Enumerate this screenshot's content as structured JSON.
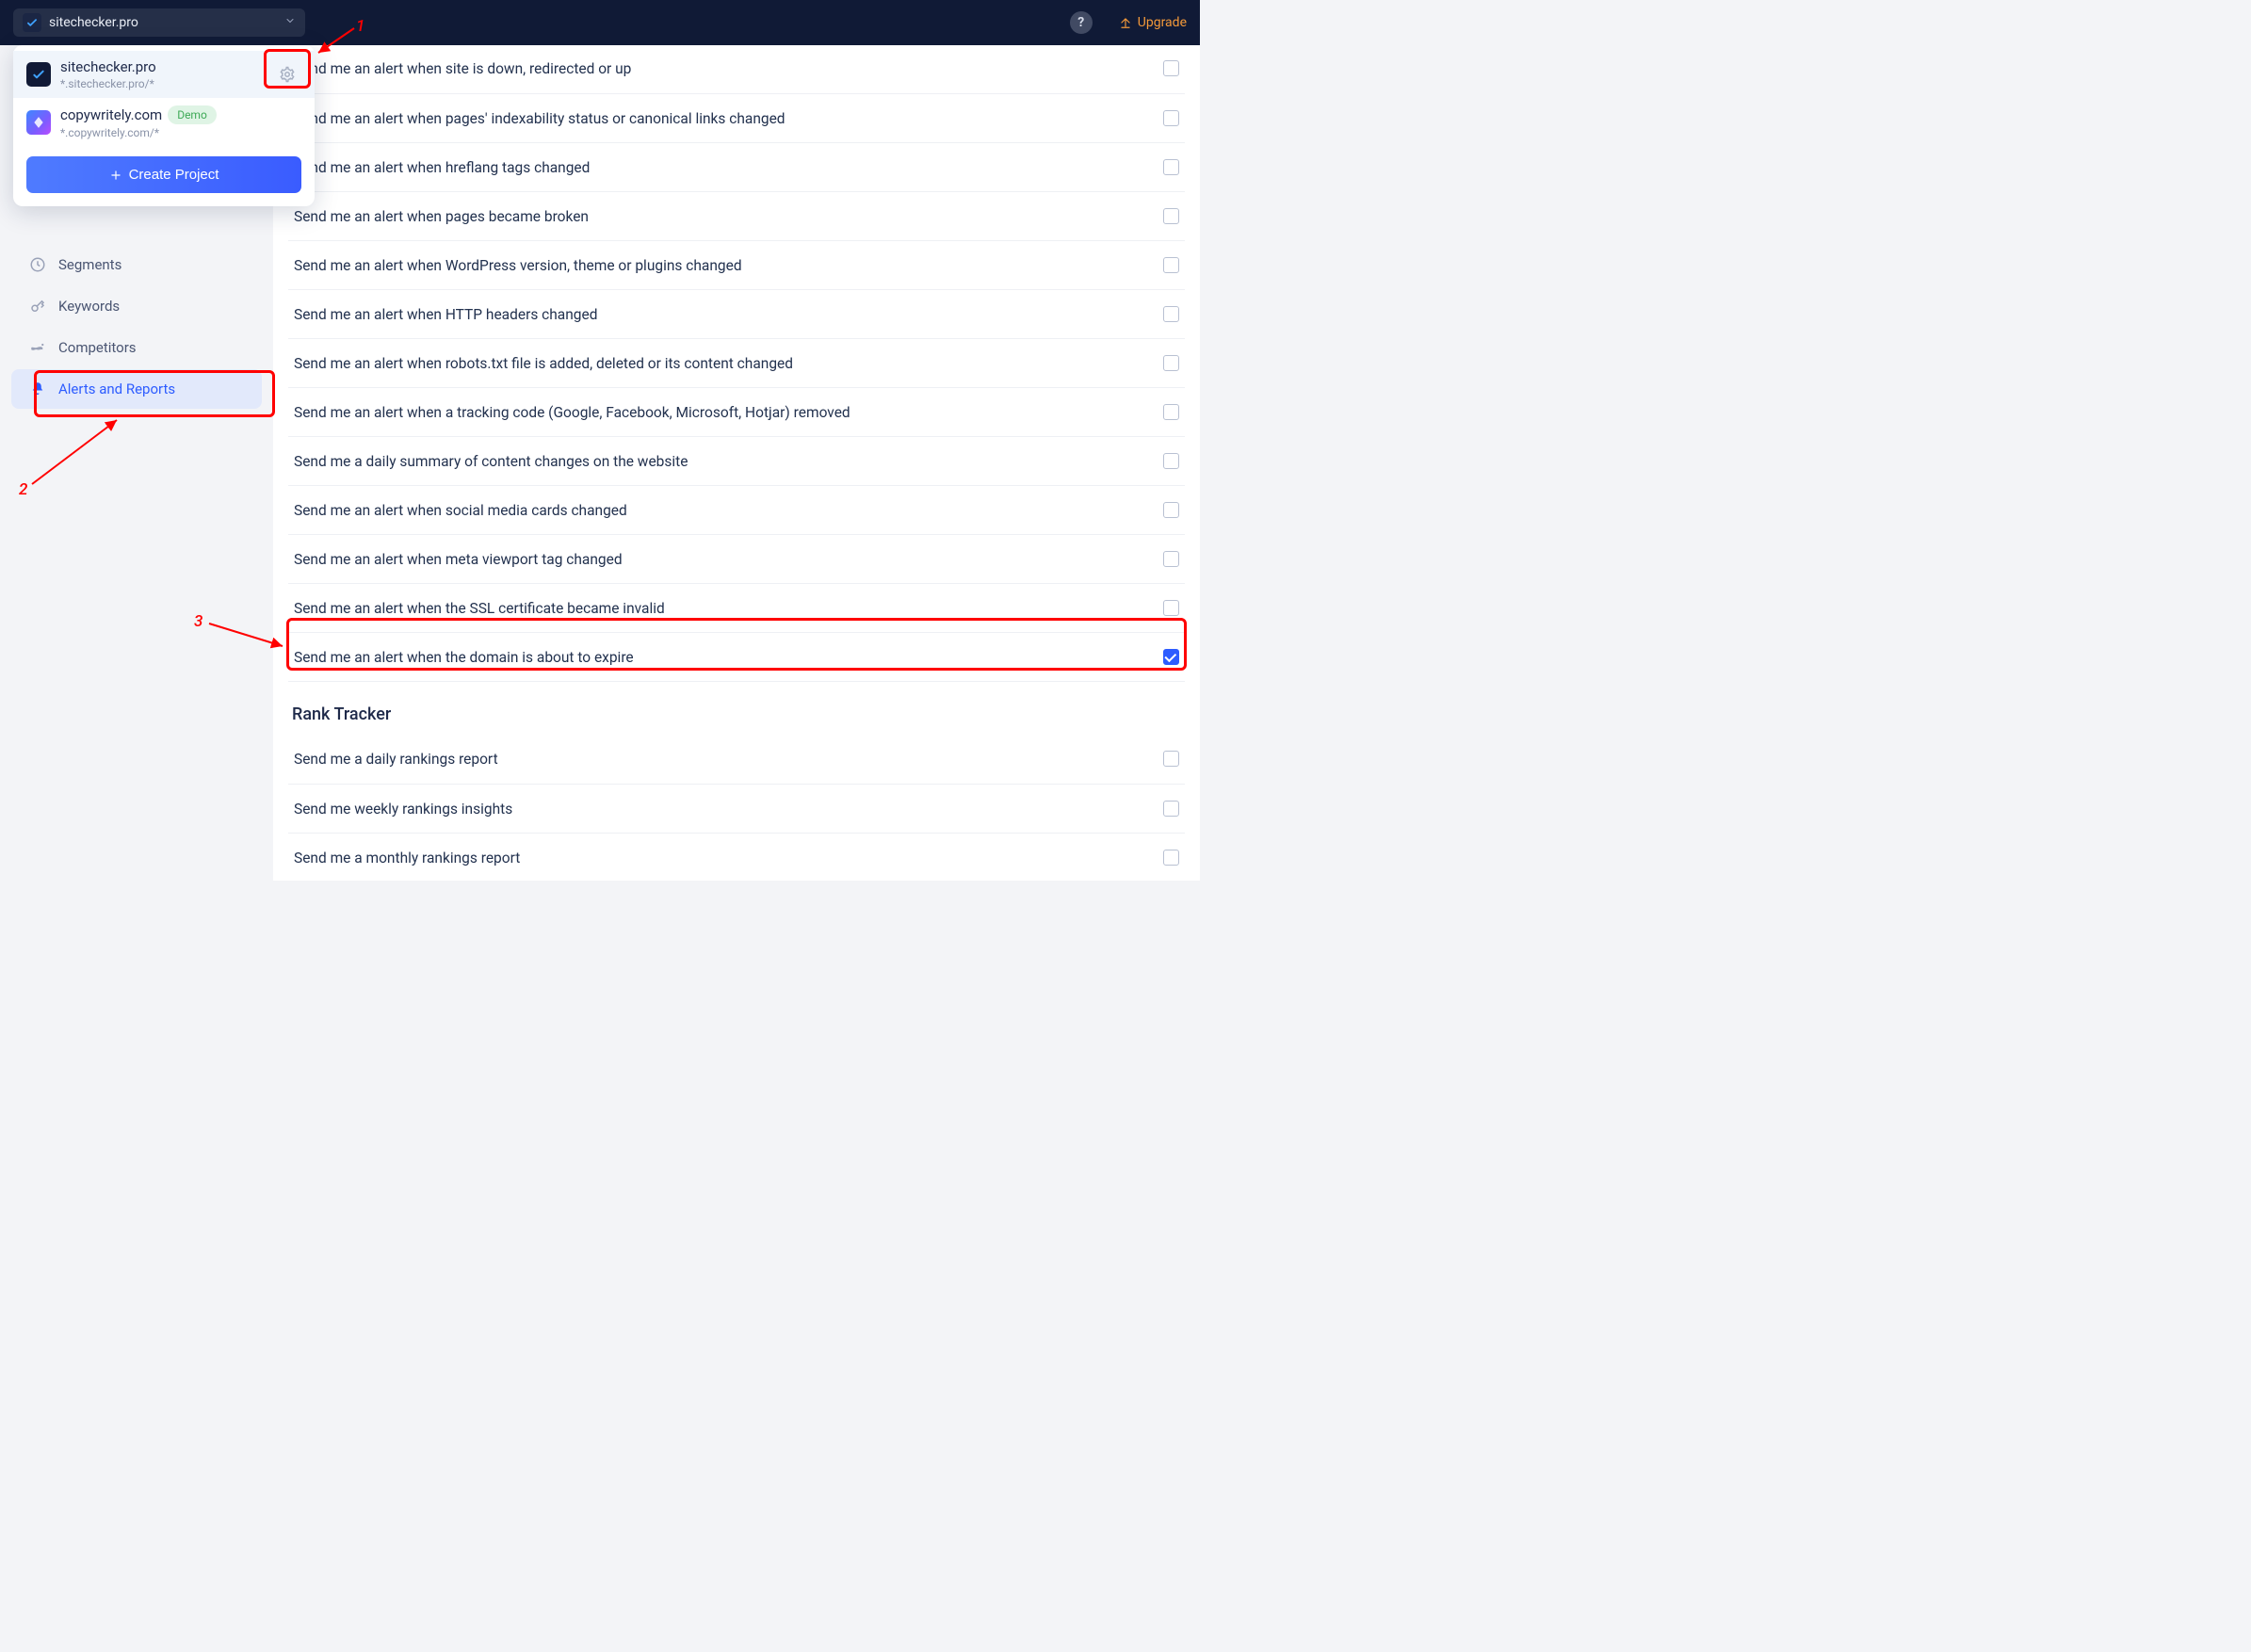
{
  "topbar": {
    "project_name": "sitechecker.pro",
    "upgrade_label": "Upgrade"
  },
  "dropdown": {
    "items": [
      {
        "name": "sitechecker.pro",
        "sub": "*.sitechecker.pro/*",
        "demo": false
      },
      {
        "name": "copywritely.com",
        "sub": "*.copywritely.com/*",
        "demo": true
      }
    ],
    "demo_label": "Demo",
    "create_label": "Create Project"
  },
  "sidebar": {
    "items": [
      {
        "key": "segments",
        "label": "Segments"
      },
      {
        "key": "keywords",
        "label": "Keywords"
      },
      {
        "key": "competitors",
        "label": "Competitors"
      },
      {
        "key": "alerts",
        "label": "Alerts and Reports",
        "active": true
      }
    ]
  },
  "alerts_group1": [
    {
      "text": "Send me an alert when site is down, redirected or up",
      "checked": false
    },
    {
      "text": "Send me an alert when pages' indexability status or canonical links changed",
      "checked": false
    },
    {
      "text": "Send me an alert when hreflang tags changed",
      "checked": false
    },
    {
      "text": "Send me an alert when pages became broken",
      "checked": false
    },
    {
      "text": "Send me an alert when WordPress version, theme or plugins changed",
      "checked": false
    },
    {
      "text": "Send me an alert when HTTP headers changed",
      "checked": false
    },
    {
      "text": "Send me an alert when robots.txt file is added, deleted or its content changed",
      "checked": false
    },
    {
      "text": "Send me an alert when a tracking code (Google, Facebook, Microsoft, Hotjar) removed",
      "checked": false
    },
    {
      "text": "Send me a daily summary of content changes on the website",
      "checked": false
    },
    {
      "text": "Send me an alert when social media cards changed",
      "checked": false
    },
    {
      "text": "Send me an alert when meta viewport tag changed",
      "checked": false
    },
    {
      "text": "Send me an alert when the SSL certificate became invalid",
      "checked": false
    },
    {
      "text": "Send me an alert when the domain is about to expire",
      "checked": true
    }
  ],
  "rank_tracker": {
    "title": "Rank Tracker",
    "items": [
      {
        "text": "Send me a daily rankings report",
        "checked": false
      },
      {
        "text": "Send me weekly rankings insights",
        "checked": false
      },
      {
        "text": "Send me a monthly rankings report",
        "checked": false
      }
    ]
  },
  "annotations": {
    "n1": "1",
    "n2": "2",
    "n3": "3"
  }
}
